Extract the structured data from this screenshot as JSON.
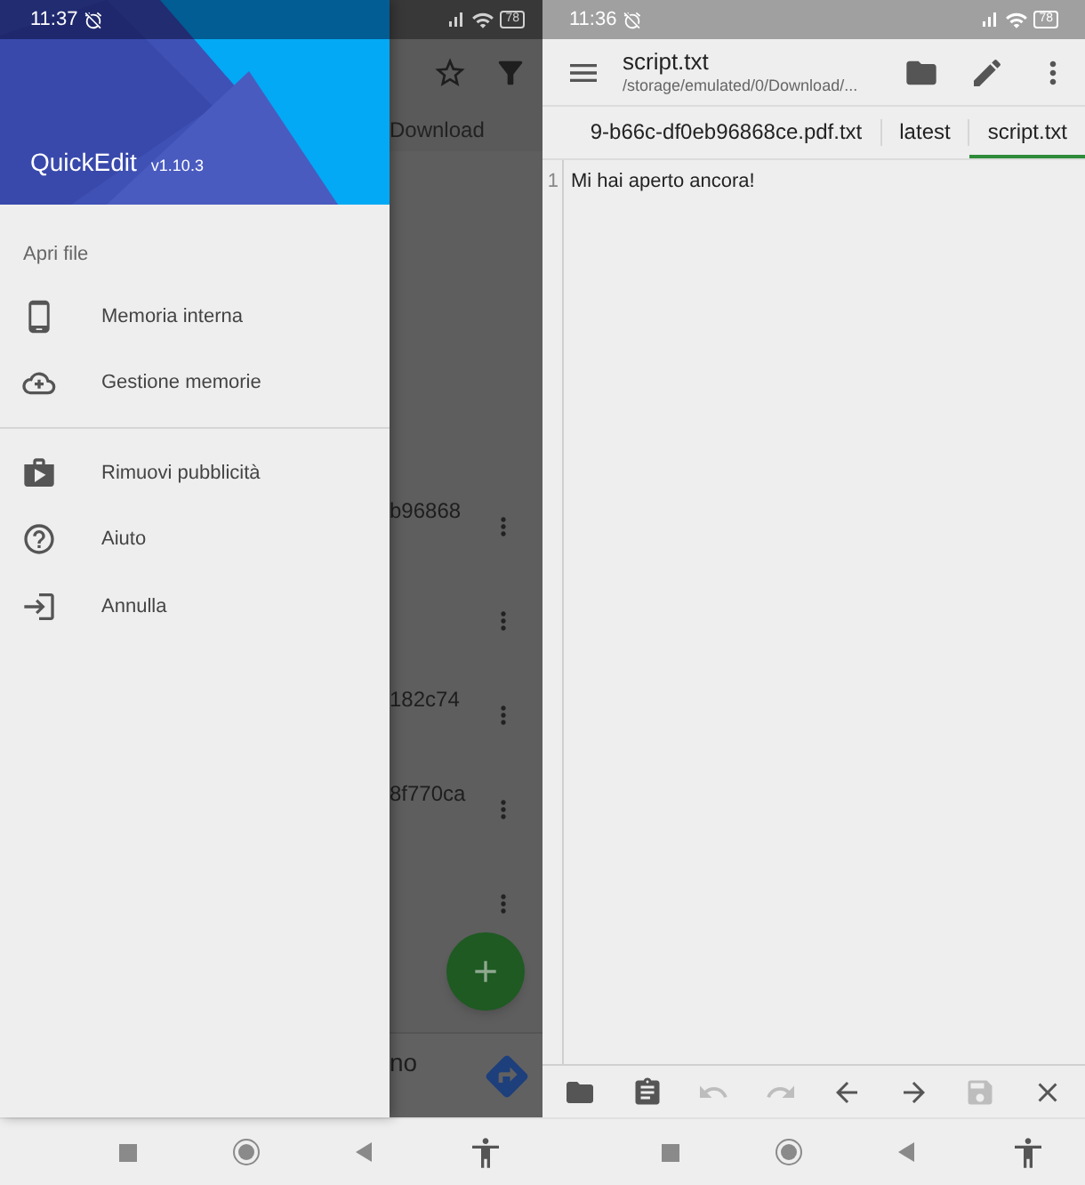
{
  "left_screen": {
    "status_bar": {
      "time": "11:37",
      "battery": "78"
    },
    "drawer": {
      "app_name": "QuickEdit",
      "version": "v1.10.3",
      "section": "Apri file",
      "groups": [
        [
          {
            "kind": "phone",
            "label": "Memoria interna"
          },
          {
            "kind": "cloud",
            "label": "Gestione memorie"
          }
        ],
        [
          {
            "kind": "store",
            "label": "Rimuovi pubblicità"
          },
          {
            "kind": "help",
            "label": "Aiuto"
          },
          {
            "kind": "exit",
            "label": "Annulla"
          }
        ]
      ]
    },
    "background_app": {
      "tab": "Download",
      "rows": [
        {
          "name": "b96868"
        },
        {},
        {
          "name": "182c74"
        },
        {
          "name": "8f770ca"
        },
        {}
      ],
      "bottom_bar_text": "no"
    }
  },
  "right_screen": {
    "status_bar": {
      "time": "11:36",
      "battery": "78"
    },
    "toolbar": {
      "title": "script.txt",
      "path": "/storage/emulated/0/Download/..."
    },
    "tabs": [
      {
        "label": "9-b66c-df0eb96868ce.pdf.txt",
        "selected": false
      },
      {
        "label": "latest",
        "selected": false
      },
      {
        "label": "script.txt",
        "selected": true
      }
    ],
    "lines": [
      {
        "number": "1",
        "text": "Mi hai aperto ancora!"
      }
    ],
    "bottom_toolbar": [
      {
        "kind": "folder",
        "disabled": false
      },
      {
        "kind": "clipboard",
        "disabled": false
      },
      {
        "kind": "undo",
        "disabled": true
      },
      {
        "kind": "redo",
        "disabled": true
      },
      {
        "kind": "back",
        "disabled": false
      },
      {
        "kind": "forward",
        "disabled": false
      },
      {
        "kind": "save",
        "disabled": true
      },
      {
        "kind": "close",
        "disabled": false
      }
    ]
  }
}
